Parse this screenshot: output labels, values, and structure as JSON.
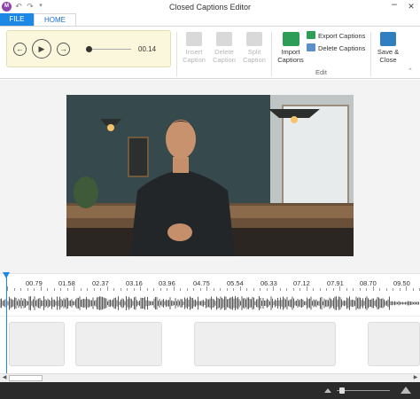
{
  "window": {
    "title": "Closed Captions Editor"
  },
  "app_icon_text": "M",
  "tabs": [
    {
      "label": "FILE",
      "selected": false
    },
    {
      "label": "HOME",
      "selected": true
    }
  ],
  "player": {
    "time": "00.14",
    "progress_fraction": 0.04
  },
  "ribbon": {
    "insert_caption": [
      "Insert",
      "Caption"
    ],
    "delete_caption": [
      "Delete",
      "Caption"
    ],
    "split_caption": [
      "Split",
      "Caption"
    ],
    "import_captions": [
      "Import",
      "Captions"
    ],
    "export_captions": "Export Captions",
    "delete_captions": "Delete Captions",
    "save_close": [
      "Save &",
      "Close"
    ],
    "group_edit": "Edit"
  },
  "timeline": {
    "ticks": [
      "00.79",
      "01.58",
      "02.37",
      "03.16",
      "03.96",
      "04.75",
      "05.54",
      "06.33",
      "07.12",
      "07.91",
      "08.70",
      "09.50"
    ]
  },
  "colors": {
    "accent": "#1e88e5",
    "player_bg": "#fbf7dc",
    "status_bar": "#2b2b2b"
  }
}
